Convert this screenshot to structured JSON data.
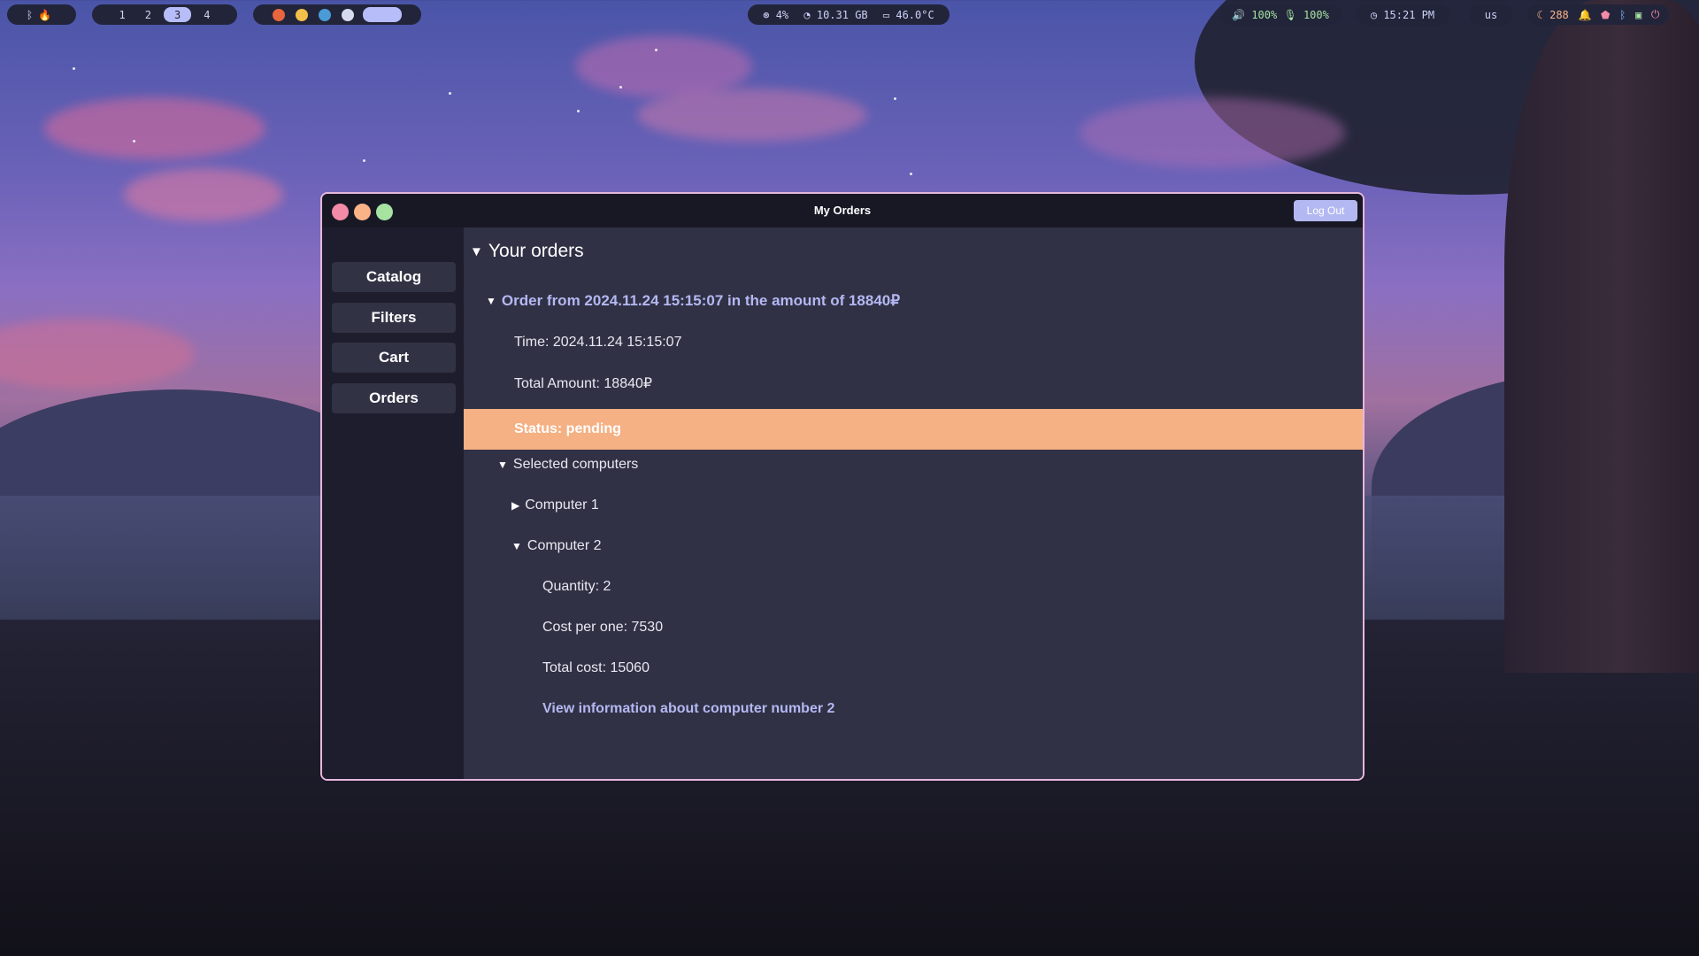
{
  "topbar": {
    "workspaces": [
      "1",
      "2",
      "3",
      "4"
    ],
    "active_workspace": "3",
    "cpu": "4%",
    "memory": "10.31 GB",
    "temperature": "46.0°C",
    "volume": "100%",
    "mic": "100%",
    "clock": "15:21 PM",
    "keyboard_layout": "us",
    "updates": "288"
  },
  "window": {
    "title": "My Orders",
    "logout_label": "Log Out"
  },
  "sidebar": {
    "items": [
      {
        "label": "Catalog"
      },
      {
        "label": "Filters"
      },
      {
        "label": "Cart"
      },
      {
        "label": "Orders"
      }
    ]
  },
  "orders": {
    "heading": "Your orders",
    "order_title": "Order from 2024.11.24 15:15:07 in the amount of 18840₽",
    "time": "Time: 2024.11.24 15:15:07",
    "total_amount": "Total Amount: 18840₽",
    "status": "Status: pending",
    "selected_heading": "Selected computers",
    "computer1": "Computer 1",
    "computer2": "Computer 2",
    "quantity": "Quantity: 2",
    "cost_per_one": "Cost per one: 7530",
    "total_cost": "Total cost: 15060",
    "view_link": "View information about computer number 2"
  },
  "colors": {
    "accent": "#b4b8f2",
    "status_bg": "#f5b083",
    "window_border": "#e6b7dc",
    "close": "#f38ba8",
    "minimize": "#fab387",
    "maximize": "#a6e3a1"
  }
}
